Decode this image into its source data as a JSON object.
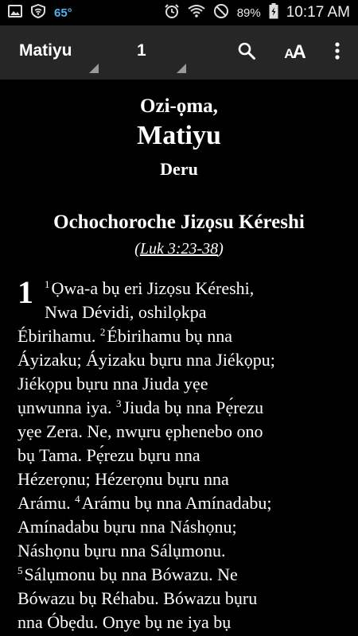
{
  "status_bar": {
    "temperature": "65°",
    "battery_percent": "89%",
    "time": "10:17 AM"
  },
  "toolbar": {
    "book": "Matiyu",
    "chapter": "1"
  },
  "heading": {
    "intro": "Ozi-ọma,",
    "book_title": "Matiyu",
    "chapter_word": "Deru"
  },
  "section": {
    "title": "Ochochoroche Jizọsu Kéreshi",
    "ref_open": "(",
    "ref_link": "Luk 3:23-38",
    "ref_close": ")"
  },
  "chapter_number": "1",
  "verses": {
    "v1": "1",
    "v2": "2",
    "v3": "3",
    "v4": "4",
    "v5": "5",
    "l1": "Ọwa-a bụ eri Jizọsu Kéreshi,",
    "l2": "Nwa Dévidi, oshilọkpa",
    "l3a": "Ébirihamu. ",
    "l3b": "Ébirihamu bụ nna",
    "l4": "Áyizaku; Áyizaku bụru nna Jiékọpu;",
    "l5": "Jiékọpu bụru nna Jiuda yẹe",
    "l6a": "ụnwunna iya. ",
    "l6b": "Jiuda bụ nna Pẹ́rezu",
    "l7": "yẹe Zera. Ne, nwụru ẹphenebo ono",
    "l8": "bụ Tama. Pẹ́rezu bụru nna",
    "l9": "Hézerọnu; Hézerọnu bụru nna",
    "l10a": "Arámu. ",
    "l10b": "Arámu bụ nna Amínadabu;",
    "l11": "Amínadabu bụru nna Náshọnu;",
    "l12": "Náshọnu bụru nna Sálụmonu.",
    "l13": "Sálụmonu bụ nna Bówazu. Ne",
    "l14": "Bówazu bụ Réhabu. Bówazu bụru",
    "l15": "nna Óbẹdu. Onye bụ ne iya bụ"
  }
}
